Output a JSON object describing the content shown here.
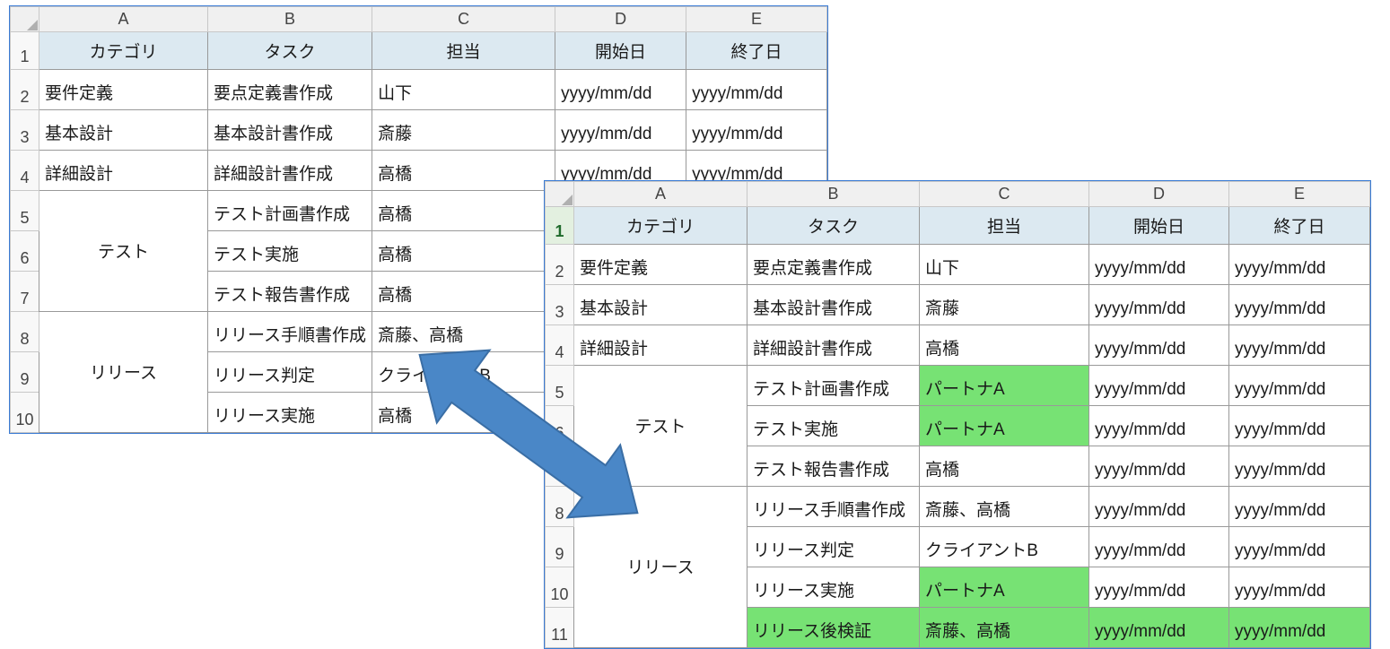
{
  "cols": [
    "A",
    "B",
    "C",
    "D",
    "E"
  ],
  "headers": {
    "A": "カテゴリ",
    "B": "タスク",
    "C": "担当",
    "D": "開始日",
    "E": "終了日"
  },
  "sheetA": {
    "rowcount": 10,
    "rows": [
      {
        "n": 1,
        "hdr": true
      },
      {
        "n": 2,
        "A": "要件定義",
        "B": "要点定義書作成",
        "C": "山下",
        "D": "yyyy/mm/dd",
        "E": "yyyy/mm/dd"
      },
      {
        "n": 3,
        "A": "基本設計",
        "B": "基本設計書作成",
        "C": "斎藤",
        "D": "yyyy/mm/dd",
        "E": "yyyy/mm/dd"
      },
      {
        "n": 4,
        "A": "詳細設計",
        "B": "詳細設計書作成",
        "C": "高橋",
        "D": "yyyy/mm/dd",
        "E": "yyyy/mm/dd"
      },
      {
        "n": 5,
        "A_merge": "テスト",
        "A_rowspan": 3,
        "B": "テスト計画書作成",
        "C": "高橋"
      },
      {
        "n": 6,
        "B": "テスト実施",
        "C": "高橋"
      },
      {
        "n": 7,
        "B": "テスト報告書作成",
        "C": "高橋"
      },
      {
        "n": 8,
        "A_merge": "リリース",
        "A_rowspan": 3,
        "B": "リリース手順書作成",
        "C": "斎藤、高橋"
      },
      {
        "n": 9,
        "B": "リリース判定",
        "C": "クライアントB"
      },
      {
        "n": 10,
        "B": "リリース実施",
        "C": "高橋"
      }
    ]
  },
  "sheetB": {
    "rowcount": 11,
    "rows": [
      {
        "n": 1,
        "hdr": true,
        "sel": true
      },
      {
        "n": 2,
        "A": "要件定義",
        "B": "要点定義書作成",
        "C": "山下",
        "D": "yyyy/mm/dd",
        "E": "yyyy/mm/dd"
      },
      {
        "n": 3,
        "A": "基本設計",
        "B": "基本設計書作成",
        "C": "斎藤",
        "D": "yyyy/mm/dd",
        "E": "yyyy/mm/dd"
      },
      {
        "n": 4,
        "A": "詳細設計",
        "B": "詳細設計書作成",
        "C": "高橋",
        "D": "yyyy/mm/dd",
        "E": "yyyy/mm/dd"
      },
      {
        "n": 5,
        "A_merge": "テスト",
        "A_rowspan": 3,
        "B": "テスト計画書作成",
        "C": "パートナA",
        "D": "yyyy/mm/dd",
        "E": "yyyy/mm/dd",
        "hiC": true
      },
      {
        "n": 6,
        "B": "テスト実施",
        "C": "パートナA",
        "D": "yyyy/mm/dd",
        "E": "yyyy/mm/dd",
        "hiC": true
      },
      {
        "n": 7,
        "B": "テスト報告書作成",
        "C": "高橋",
        "D": "yyyy/mm/dd",
        "E": "yyyy/mm/dd"
      },
      {
        "n": 8,
        "A_merge": "リリース",
        "A_rowspan": 4,
        "B": "リリース手順書作成",
        "C": "斎藤、高橋",
        "D": "yyyy/mm/dd",
        "E": "yyyy/mm/dd"
      },
      {
        "n": 9,
        "B": "リリース判定",
        "C": "クライアントB",
        "D": "yyyy/mm/dd",
        "E": "yyyy/mm/dd"
      },
      {
        "n": 10,
        "B": "リリース実施",
        "C": "パートナA",
        "D": "yyyy/mm/dd",
        "E": "yyyy/mm/dd",
        "hiC": true
      },
      {
        "n": 11,
        "B": "リリース後検証",
        "C": "斎藤、高橋",
        "D": "yyyy/mm/dd",
        "E": "yyyy/mm/dd",
        "hiB": true,
        "hiC": true,
        "hiD": true,
        "hiE": true
      }
    ]
  },
  "colors": {
    "hdr_fill": "#dce9f1",
    "highlight": "#77e274",
    "arrow": "#4a87c7",
    "arrow_border": "#3a6ea5"
  }
}
